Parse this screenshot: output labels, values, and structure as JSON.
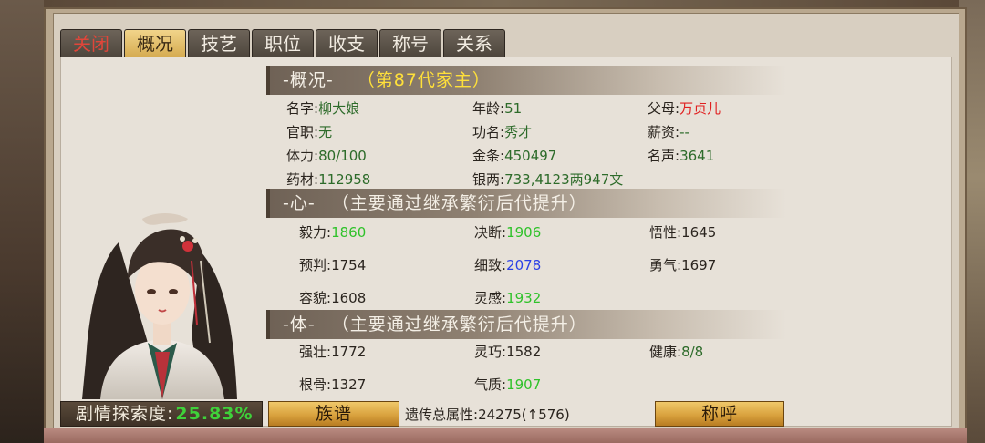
{
  "tabs": [
    "关闭",
    "概况",
    "技艺",
    "职位",
    "收支",
    "称号",
    "关系"
  ],
  "overview": {
    "header": "-概况-",
    "generation": "（第87代家主）",
    "rows": [
      [
        {
          "label": "名字:",
          "value": "柳大娘"
        },
        {
          "label": "年龄:",
          "value": "51"
        },
        {
          "label": "父母:",
          "value": "万贞儿"
        }
      ],
      [
        {
          "label": "官职:",
          "value": "无"
        },
        {
          "label": "功名:",
          "value": "秀才"
        },
        {
          "label": "薪资:",
          "value": "--"
        }
      ],
      [
        {
          "label": "体力:",
          "value": "80/100"
        },
        {
          "label": "金条:",
          "value": "450497"
        },
        {
          "label": "名声:",
          "value": "3641"
        }
      ],
      [
        {
          "label": "药材:",
          "value": "112958"
        },
        {
          "label": "银两:",
          "value": "733,4123两947文"
        }
      ]
    ]
  },
  "heart": {
    "header": "-心-",
    "note": "（主要通过继承繁衍后代提升）",
    "rows": [
      [
        {
          "label": "毅力:",
          "value": "1860"
        },
        {
          "label": "决断:",
          "value": "1906"
        },
        {
          "label": "悟性:",
          "value": "1645"
        }
      ],
      [
        {
          "label": "预判:",
          "value": "1754"
        },
        {
          "label": "细致:",
          "value": "2078"
        },
        {
          "label": "勇气:",
          "value": "1697"
        }
      ],
      [
        {
          "label": "容貌:",
          "value": "1608"
        },
        {
          "label": "灵感:",
          "value": "1932"
        }
      ]
    ]
  },
  "body_section": {
    "header": "-体-",
    "note": "（主要通过继承繁衍后代提升）",
    "rows": [
      [
        {
          "label": "强壮:",
          "value": "1772"
        },
        {
          "label": "灵巧:",
          "value": "1582"
        },
        {
          "label": "健康:",
          "value": "8/8"
        }
      ],
      [
        {
          "label": "根骨:",
          "value": "1327"
        },
        {
          "label": "气质:",
          "value": "1907"
        }
      ]
    ]
  },
  "footer": {
    "explore_label": "剧情探索度:",
    "explore_pct": "25.83%",
    "clan_button": "族谱",
    "genetic_label": "遗传总属性:",
    "genetic_value": "24275",
    "genetic_delta": "(↑576)",
    "title_button": "称呼"
  },
  "colors": {
    "value_green": "#2d6b2a",
    "value_red": "#e02020",
    "value_bright_green": "#2fc22a",
    "value_blue": "#2a3fe6",
    "highlight_yellow": "#ffe03a"
  },
  "icons": {
    "portrait": "character-portrait"
  }
}
